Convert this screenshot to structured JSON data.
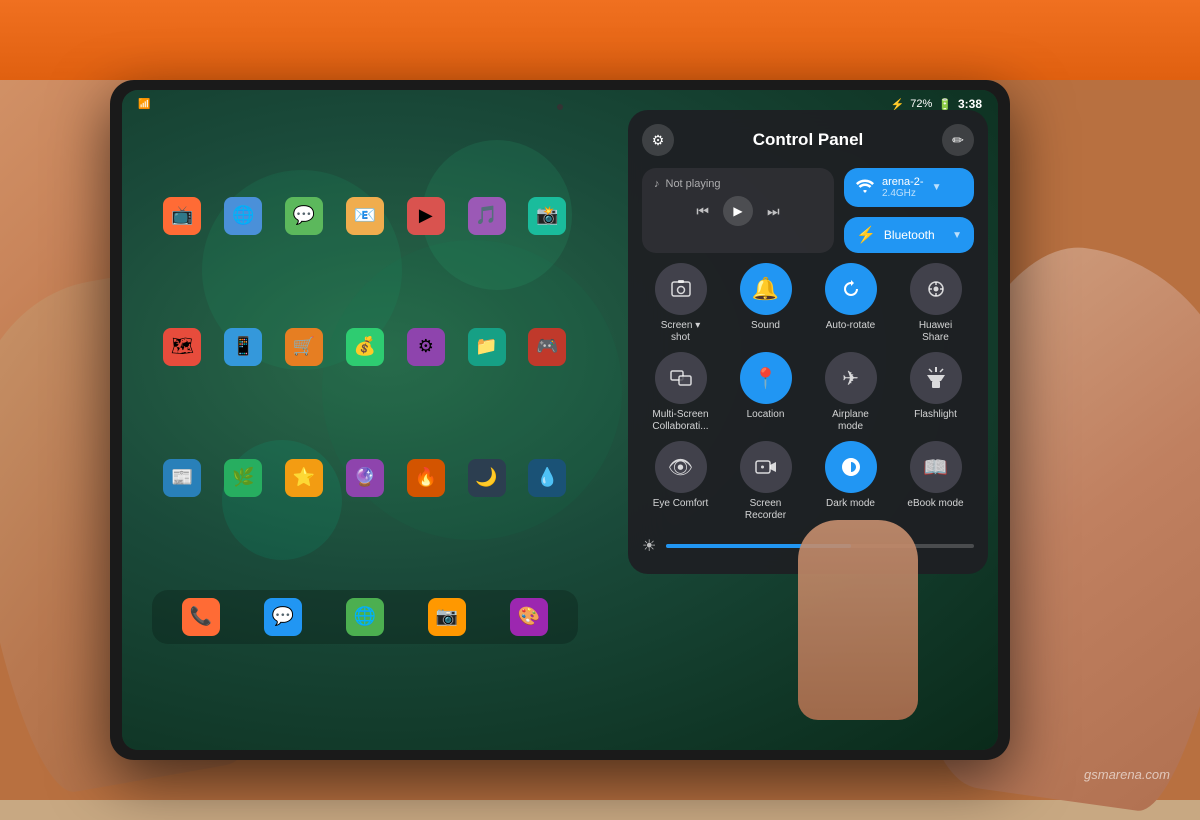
{
  "scene": {
    "bg_color": "#c8845a",
    "orange_top": "#f07020"
  },
  "watermark": "gsmarena.com",
  "status_bar": {
    "bluetooth_icon": "⚡",
    "battery_level": "72%",
    "battery_icon": "🔋",
    "time": "3:38"
  },
  "control_panel": {
    "title": "Control Panel",
    "settings_icon": "⚙",
    "edit_icon": "✏",
    "media": {
      "music_note": "♪",
      "status": "Not playing",
      "prev_icon": "⏮",
      "play_icon": "▶",
      "next_icon": "⏭"
    },
    "wifi": {
      "icon": "wifi",
      "name": "arena-2-",
      "detail": "2.4GHz",
      "chevron": "▼"
    },
    "bluetooth": {
      "icon": "⚡",
      "label": "Bluetooth",
      "chevron": "▼"
    },
    "toggles": [
      {
        "id": "screenshot",
        "icon": "📷",
        "label": "Screen▾\nshot",
        "active": false
      },
      {
        "id": "sound",
        "icon": "🔔",
        "label": "Sound",
        "active": true
      },
      {
        "id": "auto_rotate",
        "icon": "🔄",
        "label": "Auto-rotate",
        "active": true
      },
      {
        "id": "huawei_share",
        "icon": "📡",
        "label": "Huawei\nShare",
        "active": false
      },
      {
        "id": "multiscreen",
        "icon": "⊞",
        "label": "Multi-Screen\nCollaborati...",
        "active": false
      },
      {
        "id": "location",
        "icon": "📍",
        "label": "Location",
        "active": true
      },
      {
        "id": "airplane",
        "icon": "✈",
        "label": "Airplane\nmode",
        "active": false
      },
      {
        "id": "flashlight",
        "icon": "🔦",
        "label": "Flashlight",
        "active": false
      },
      {
        "id": "eye_comfort",
        "icon": "👁",
        "label": "Eye Comfort",
        "active": false
      },
      {
        "id": "screen_recorder",
        "icon": "⏺",
        "label": "Screen\nRecorder",
        "active": false
      },
      {
        "id": "dark_mode",
        "icon": "◑",
        "label": "Dark mode",
        "active": true
      },
      {
        "id": "ebook_mode",
        "icon": "📖",
        "label": "eBook mode",
        "active": false
      }
    ],
    "brightness": {
      "icon": "☀",
      "level": 60
    }
  },
  "app_icons": [
    {
      "color": "#ff6b35",
      "emoji": "📺"
    },
    {
      "color": "#4a90d9",
      "emoji": "🌐"
    },
    {
      "color": "#5cb85c",
      "emoji": "💬"
    },
    {
      "color": "#f0ad4e",
      "emoji": "📧"
    },
    {
      "color": "#d9534f",
      "emoji": "▶"
    },
    {
      "color": "#9b59b6",
      "emoji": "🎵"
    },
    {
      "color": "#1abc9c",
      "emoji": "📸"
    },
    {
      "color": "#e74c3c",
      "emoji": "🗺"
    },
    {
      "color": "#3498db",
      "emoji": "📱"
    },
    {
      "color": "#e67e22",
      "emoji": "🛒"
    },
    {
      "color": "#2ecc71",
      "emoji": "💰"
    },
    {
      "color": "#8e44ad",
      "emoji": "⚙"
    },
    {
      "color": "#16a085",
      "emoji": "📁"
    },
    {
      "color": "#c0392b",
      "emoji": "🎮"
    }
  ]
}
